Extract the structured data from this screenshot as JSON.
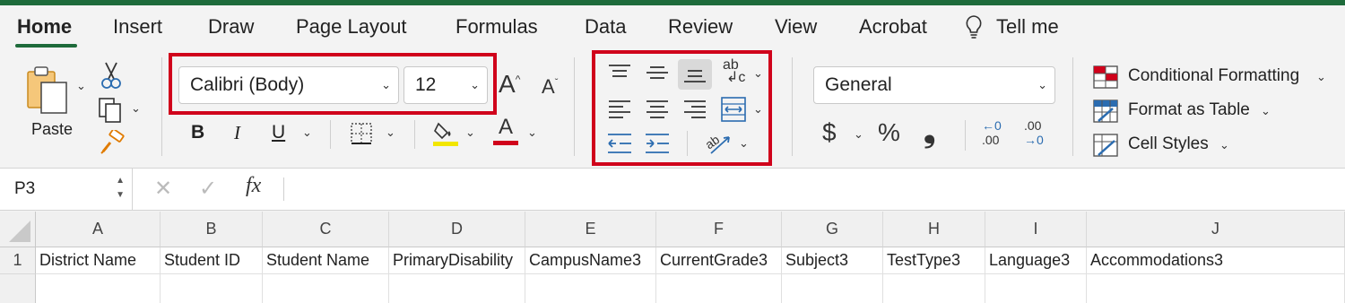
{
  "tabs": [
    {
      "label": "Home",
      "active": true
    },
    {
      "label": "Insert"
    },
    {
      "label": "Draw"
    },
    {
      "label": "Page Layout"
    },
    {
      "label": "Formulas"
    },
    {
      "label": "Data"
    },
    {
      "label": "Review"
    },
    {
      "label": "View"
    },
    {
      "label": "Acrobat"
    }
  ],
  "tell_me": "Tell me",
  "clipboard": {
    "paste_label": "Paste"
  },
  "font": {
    "name": "Calibri (Body)",
    "size": "12",
    "bold": "B",
    "italic": "I",
    "underline": "U",
    "grow": "A",
    "shrink": "A",
    "font_color_glyph": "A"
  },
  "alignment": {
    "wrap_glyph": "ab c"
  },
  "number": {
    "format": "General",
    "currency": "$",
    "percent": "%",
    "comma": "❟",
    "inc_decimal_top": "←0",
    "inc_decimal_bottom": ".00",
    "dec_decimal_top": ".00",
    "dec_decimal_bottom": "→0"
  },
  "styles": {
    "conditional": "Conditional Formatting",
    "table": "Format as Table",
    "cell": "Cell Styles"
  },
  "formula_bar": {
    "name_box": "P3",
    "fx": "fx",
    "value": ""
  },
  "sheet": {
    "columns": [
      "A",
      "B",
      "C",
      "D",
      "E",
      "F",
      "G",
      "H",
      "I",
      "J"
    ],
    "rows": [
      {
        "header": "1",
        "cells": [
          "District Name",
          "Student ID",
          "Student Name",
          "PrimaryDisability",
          "CampusName3",
          "CurrentGrade3",
          "Subject3",
          "TestType3",
          "Language3",
          "Accommodations3"
        ]
      }
    ]
  },
  "colors": {
    "accent": "#1e6b3b",
    "highlight_box": "#d0021b",
    "fill_yellow": "#f2e600",
    "font_red": "#d0021b"
  }
}
